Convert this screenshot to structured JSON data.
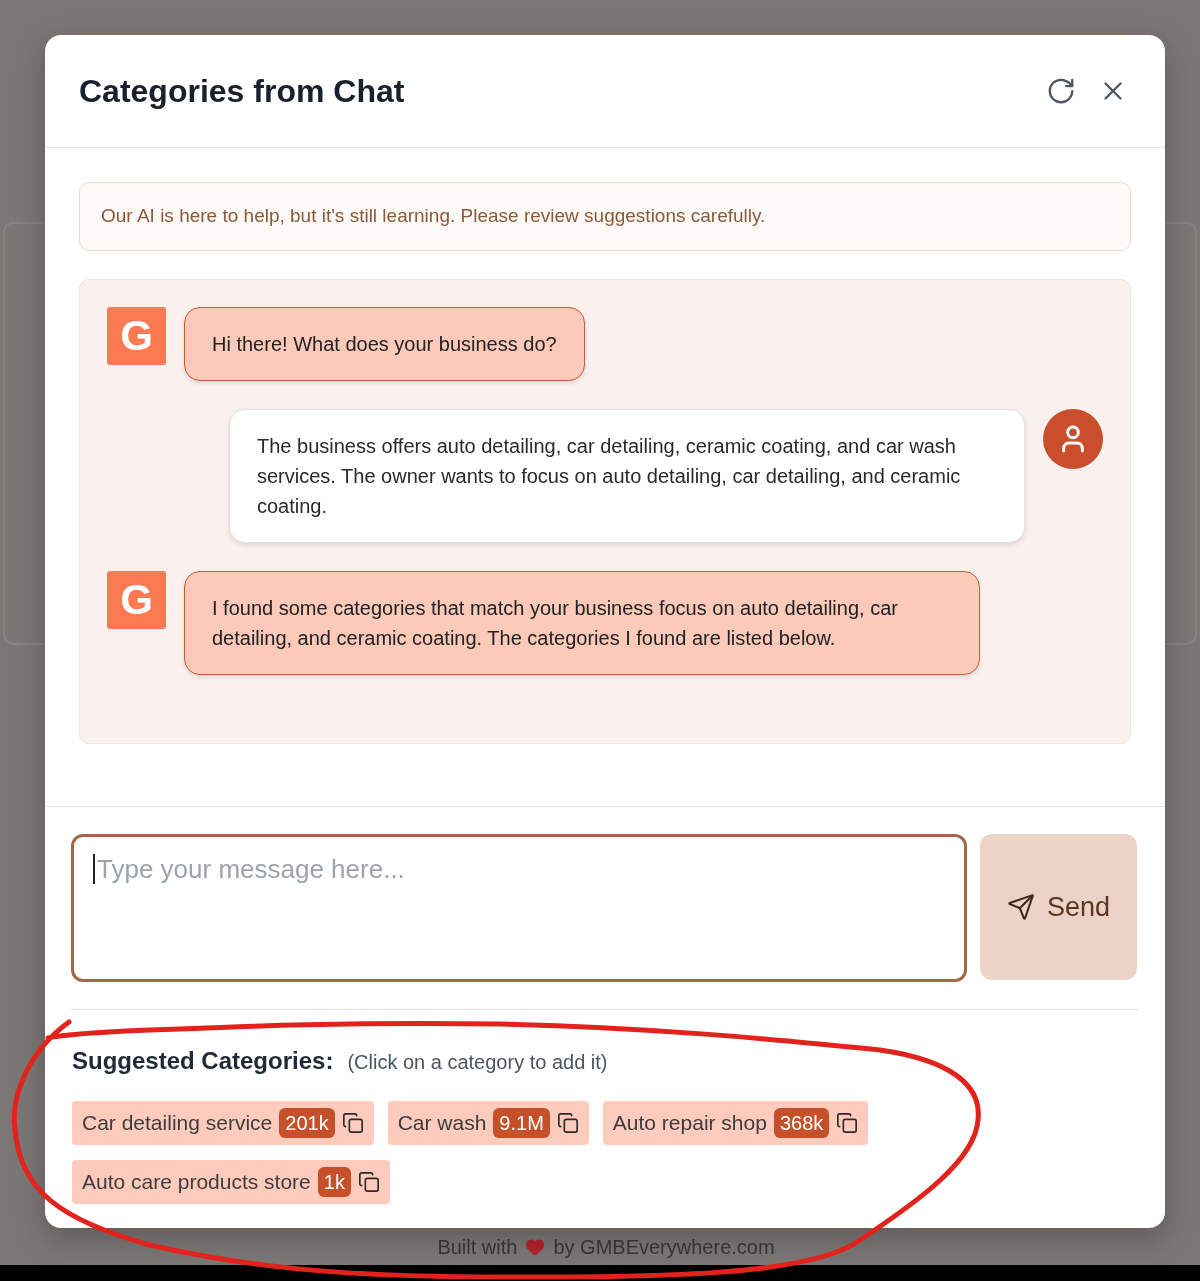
{
  "dialog": {
    "title": "Categories from Chat"
  },
  "notice": {
    "text": "Our AI is here to help, but it's still learning. Please review suggestions carefully."
  },
  "messages": [
    {
      "kind": "assistant",
      "avatar": "G",
      "text": "Hi there! What does your business do?"
    },
    {
      "kind": "user",
      "text": "The business offers auto detailing, car detailing, ceramic coating, and car wash services. The owner wants to focus on auto detailing, car detailing, and ceramic coating."
    },
    {
      "kind": "assistant",
      "avatar": "G",
      "text": "I found some categories that match your business focus on auto detailing, car detailing, and ceramic coating. The categories I found are listed below."
    }
  ],
  "composer": {
    "placeholder": "Type your message here...",
    "focused": true,
    "send_label": "Send"
  },
  "suggestions": {
    "heading": "Suggested Categories:",
    "hint": "(Click on a category to add it)",
    "categories": [
      {
        "name": "Car detailing service",
        "count": "201k"
      },
      {
        "name": "Car wash",
        "count": "9.1M"
      },
      {
        "name": "Auto repair shop",
        "count": "368k"
      },
      {
        "name": "Auto care products store",
        "count": "1k"
      }
    ]
  },
  "footer": {
    "before": "Built with",
    "after": "by GMBEverywhere.com"
  },
  "annotations": [
    {
      "kind": "freehand_loop"
    }
  ]
}
